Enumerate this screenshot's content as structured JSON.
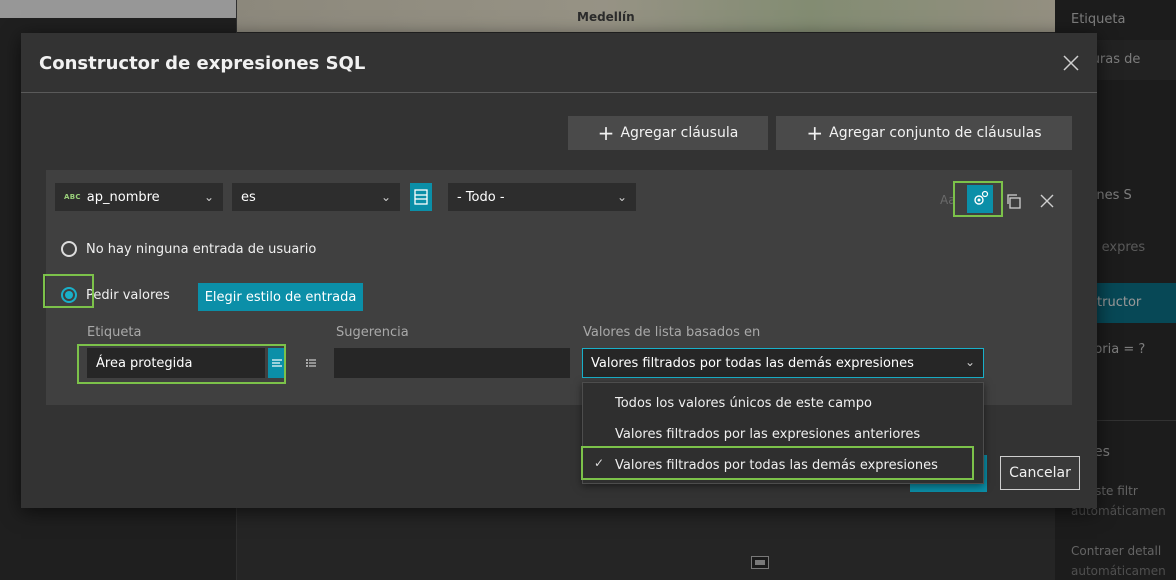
{
  "background": {
    "map_city": "Medellín",
    "panel": {
      "etiqueta": "Etiqueta",
      "coberturas": "berturas de",
      "o": "o",
      "expresiones": "resiones S",
      "agregue": "egue expres",
      "constructor": "Constructor",
      "categoria": "ategoria = ?",
      "acciones": "ciones",
      "car_filtro": "car este filtr",
      "automaticamente1": "automáticamen",
      "contraer": "Contraer detall",
      "automaticamente2": "automáticamen"
    }
  },
  "dialog": {
    "title": "Constructor de expresiones SQL",
    "add_clause": "Agregar cláusula",
    "add_clause_set": "Agregar conjunto de cláusulas",
    "clause": {
      "field_type": "ABC",
      "field": "ap_nombre",
      "operator": "es",
      "value": "- Todo -",
      "case_label": "Aa"
    },
    "radio_none": "No hay ninguna entrada de usuario",
    "radio_ask": "Pedir valores",
    "choose_style": "Elegir estilo de entrada",
    "etiqueta_label": "Etiqueta",
    "etiqueta_value": "Área protegida",
    "sugerencia_label": "Sugerencia",
    "sugerencia_value": "",
    "list_label": "Valores de lista basados en",
    "list_selected": "Valores filtrados por todas las demás expresiones",
    "list_options": [
      "Todos los valores únicos de este campo",
      "Valores filtrados por las expresiones anteriores",
      "Valores filtrados por todas las demás expresiones"
    ],
    "cancel": "Cancelar"
  }
}
